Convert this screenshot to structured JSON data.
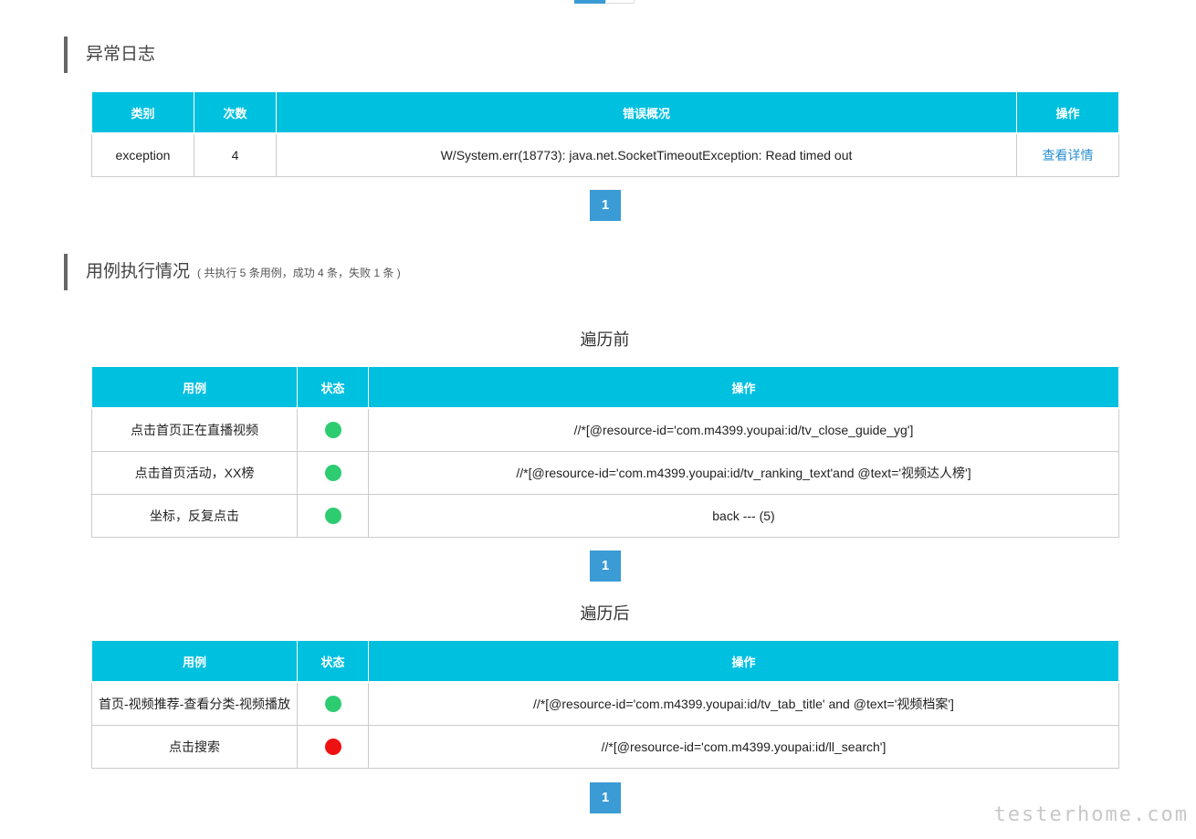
{
  "top_pager": {
    "active": "",
    "next": ""
  },
  "exception_log": {
    "title": "异常日志",
    "headers": [
      "类别",
      "次数",
      "错误概况",
      "操作"
    ],
    "rows": [
      {
        "category": "exception",
        "count": "4",
        "summary": "W/System.err(18773): java.net.SocketTimeoutException: Read timed out",
        "action": "查看详情"
      }
    ],
    "page": "1"
  },
  "case_execution": {
    "title": "用例执行情况",
    "summary": "( 共执行 5 条用例，成功 4 条，失败 1 条 )",
    "before": {
      "heading": "遍历前",
      "headers": [
        "用例",
        "状态",
        "操作"
      ],
      "rows": [
        {
          "case": "点击首页正在直播视频",
          "status": "success",
          "op": "//*[@resource-id='com.m4399.youpai:id/tv_close_guide_yg']"
        },
        {
          "case": "点击首页活动，XX榜",
          "status": "success",
          "op": "//*[@resource-id='com.m4399.youpai:id/tv_ranking_text'and @text='视频达人榜']"
        },
        {
          "case": "坐标，反复点击",
          "status": "success",
          "op": "back --- (5)"
        }
      ],
      "page": "1"
    },
    "after": {
      "heading": "遍历后",
      "headers": [
        "用例",
        "状态",
        "操作"
      ],
      "rows": [
        {
          "case": "首页-视频推荐-查看分类-视频播放",
          "status": "success",
          "op": "//*[@resource-id='com.m4399.youpai:id/tv_tab_title' and @text='视频档案']"
        },
        {
          "case": "点击搜索",
          "status": "fail",
          "op": "//*[@resource-id='com.m4399.youpai:id/ll_search']"
        }
      ],
      "page": "1"
    }
  },
  "status_colors": {
    "success": "#2ecc71",
    "fail": "#ee1111"
  },
  "watermark": "testerhome.com"
}
